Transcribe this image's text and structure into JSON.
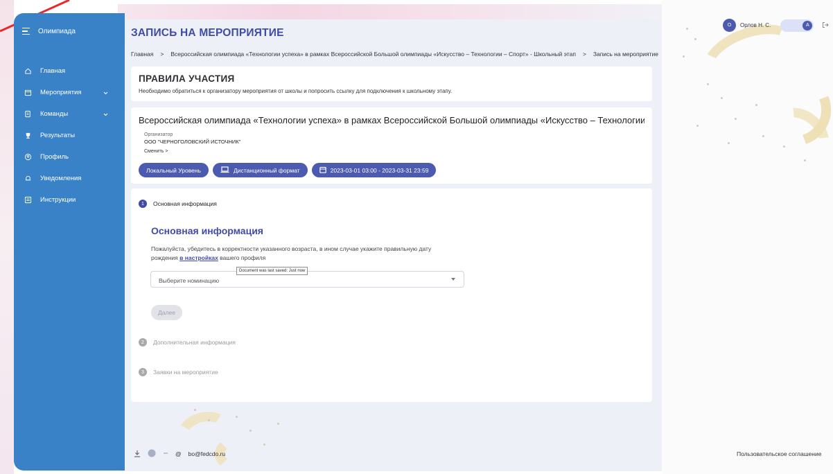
{
  "sidebar": {
    "title": "Олимпиада",
    "items": [
      {
        "label": "Главная",
        "icon": "home-icon"
      },
      {
        "label": "Мероприятия",
        "icon": "calendar-icon",
        "expandable": true
      },
      {
        "label": "Команды",
        "icon": "team-icon",
        "expandable": true
      },
      {
        "label": "Результаты",
        "icon": "trophy-icon"
      },
      {
        "label": "Профиль",
        "icon": "profile-icon"
      },
      {
        "label": "Уведомления",
        "icon": "bell-icon"
      },
      {
        "label": "Инструкции",
        "icon": "document-icon"
      }
    ]
  },
  "header": {
    "title": "ЗАПИСЬ НА МЕРОПРИЯТИЕ",
    "breadcrumb": [
      "Главная",
      "Всероссийская олимпиада «Технологии успеха» в рамках Всероссийской Большой олимпиады «Искусство – Технологии – Спорт» - Школьный этап",
      "Запись на мероприятие"
    ]
  },
  "user": {
    "initial": "О",
    "name": "Орлов Н. С.",
    "toggle_label": "A"
  },
  "rules": {
    "title": "ПРАВИЛА УЧАСТИЯ",
    "text": "Необходимо обратиться к организатору мероприятия от школы и попросить ссылку для подключения к школьному этапу."
  },
  "event": {
    "title": "Всероссийская олимпиада «Технологии успеха» в рамках Всероссийской Большой олимпиады «Искусство – Технологии ...",
    "organizer_label": "Организатор",
    "organizer": "ООО \"ЧЕРНОГОЛОВСКИЙ ИСТОЧНИК\"",
    "change_label": "Сменить >",
    "chips": {
      "level": "Локальный Уровень",
      "format": "Дистанционный формат",
      "dates": "2023-03-01 03:00 - 2023-03-31 23:59"
    }
  },
  "steps": [
    {
      "number": "1",
      "label": "Основная информация"
    },
    {
      "number": "2",
      "label": "Дополнительная информация"
    },
    {
      "number": "3",
      "label": "Заявки на мероприятие"
    }
  ],
  "form": {
    "section_title": "Основная информация",
    "hint_before": "Пожалуйста, убедитесь в корректности указанного возраста, в ином случае укажите правильную дату рождения ",
    "hint_link": "в настройках",
    "hint_after": " вашего профиля",
    "select_placeholder": "Выберите номинацию",
    "tooltip": "Document was last saved: Just now",
    "next_button": "Далее"
  },
  "footer": {
    "email": "bo@fedcdo.ru",
    "agreement": "Пользовательское соглашение"
  },
  "colors": {
    "sidebar": "#3a82c8",
    "accent": "#3f4ba4",
    "chip": "#4c5bb0"
  }
}
